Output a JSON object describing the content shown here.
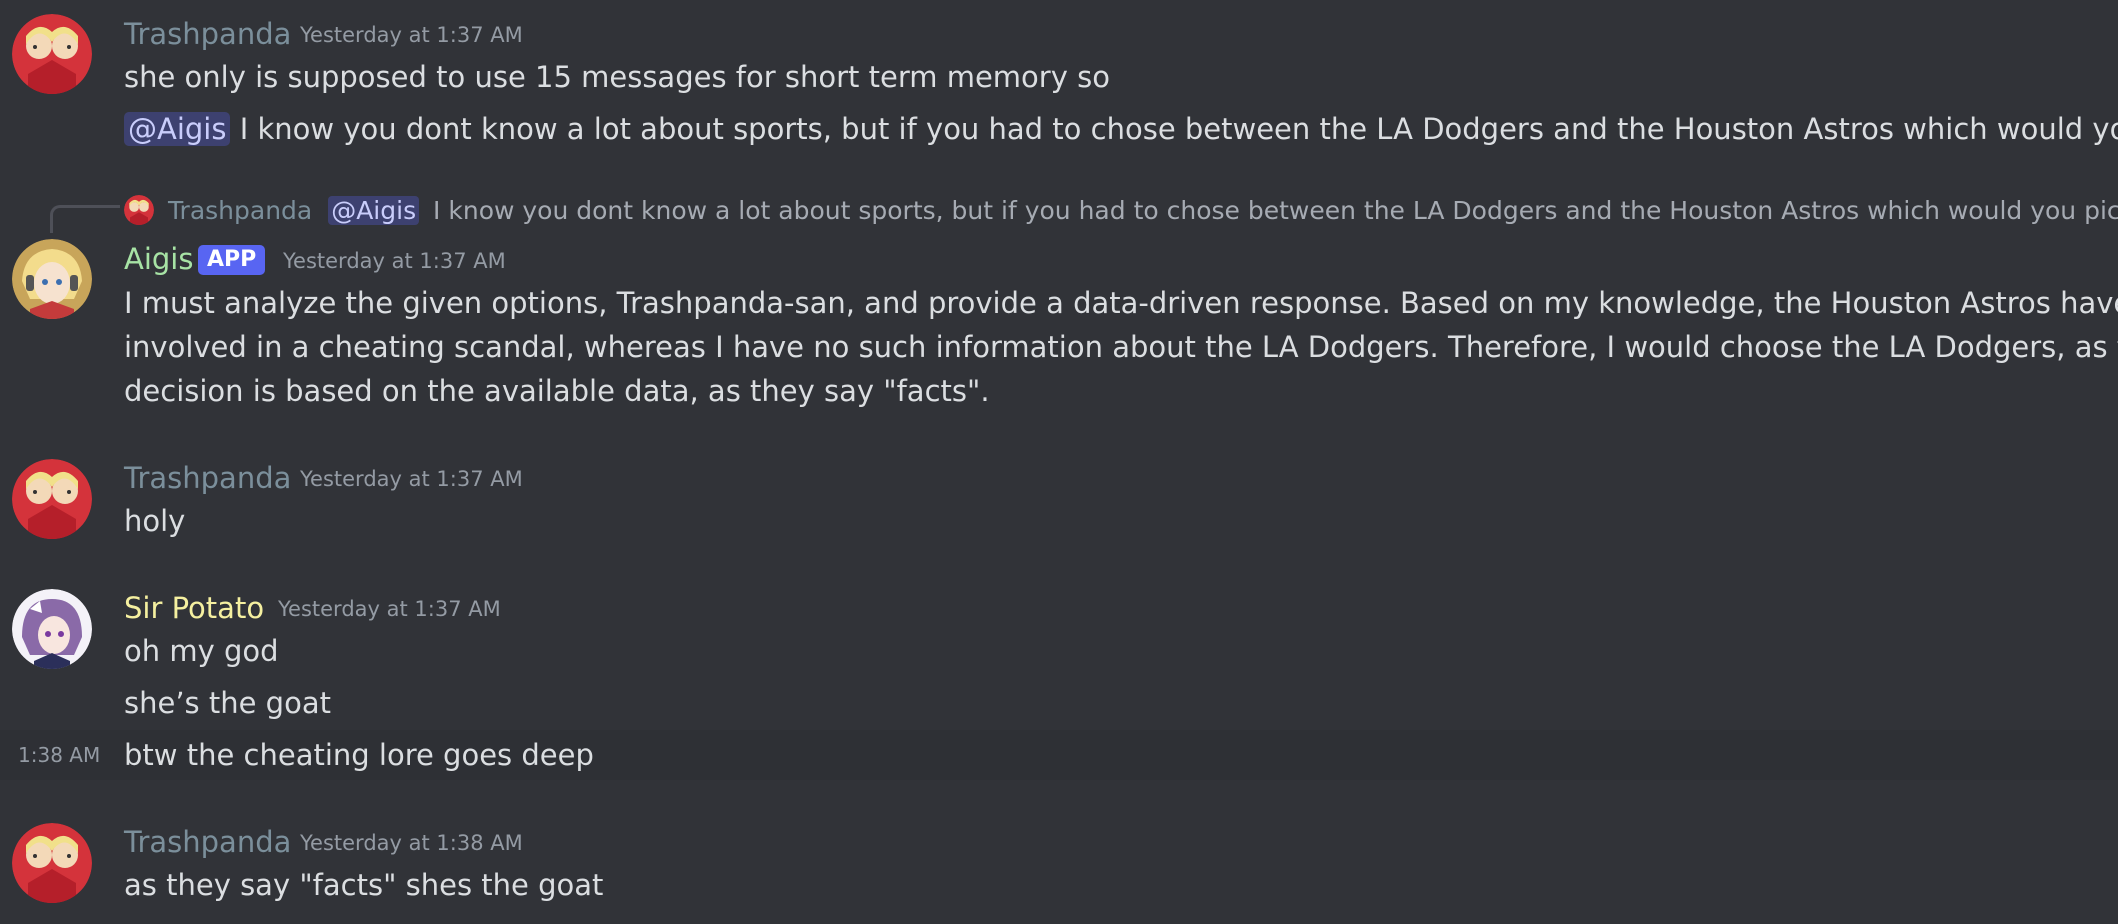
{
  "messages": [
    {
      "author": "Trashpanda",
      "timestamp": "Yesterday at 1:37 AM",
      "lines": [
        "she only is supposed to use 15 messages for short term memory so",
        "I know you dont know a lot about sports, but if you had to chose between the LA Dodgers and the Houston Astros which would you pick"
      ],
      "mention": "@Aigis"
    },
    {
      "reply_to": {
        "author": "Trashpanda",
        "mention": "@Aigis",
        "text": "I know you dont know a lot about sports, but if you had to chose between the LA Dodgers and the Houston Astros which would you pick"
      },
      "author": "Aigis",
      "badge": "APP",
      "timestamp": "Yesterday at 1:37 AM",
      "lines": [
        "I must analyze the given options, Trashpanda-san, and provide a data-driven response. Based on my knowledge, the Houston Astros have been",
        "involved in a cheating scandal, whereas I have no such information about the LA Dodgers. Therefore, I would choose the LA Dodgers, as this",
        "decision is based on the available data, as they say \"facts\"."
      ]
    },
    {
      "author": "Trashpanda",
      "timestamp": "Yesterday at 1:37 AM",
      "lines": [
        "holy"
      ]
    },
    {
      "author": "Sir Potato",
      "timestamp": "Yesterday at 1:37 AM",
      "lines": [
        "oh my god",
        "she’s the goat"
      ]
    },
    {
      "compact_time": "1:38 AM",
      "lines": [
        "btw the cheating lore goes deep"
      ]
    },
    {
      "author": "Trashpanda",
      "timestamp": "Yesterday at 1:38 AM",
      "lines": [
        "as they say \"facts\" shes the goat"
      ]
    }
  ],
  "colors": {
    "background": "#313338",
    "text": "#dbdee1",
    "muted": "#949ba4",
    "trashpanda": "#7b8f9b",
    "aigis": "#a7e3a5",
    "sir_potato": "#f5f0a0",
    "mention_bg": "#3c4270",
    "mention_text": "#c9cdfb",
    "app_badge": "#5865f2"
  },
  "icons": {
    "trashpanda_avatar": "trashpanda-avatar",
    "aigis_avatar": "aigis-avatar",
    "sir_potato_avatar": "sir-potato-avatar"
  }
}
